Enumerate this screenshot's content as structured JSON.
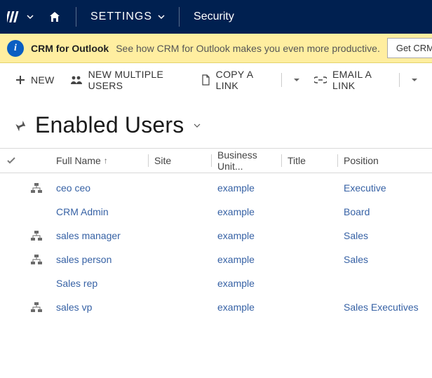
{
  "topnav": {
    "area_label": "SETTINGS",
    "subarea_label": "Security"
  },
  "notice": {
    "title": "CRM for Outlook",
    "message": "See how CRM for Outlook makes you even more productive.",
    "button_label": "Get CRM for Outlook"
  },
  "commands": {
    "new": "NEW",
    "new_multiple": "NEW MULTIPLE USERS",
    "copy_link": "COPY A LINK",
    "email_link": "EMAIL A LINK"
  },
  "view": {
    "title": "Enabled Users"
  },
  "grid": {
    "columns": {
      "full_name": "Full Name",
      "site": "Site",
      "business_unit": "Business Unit...",
      "title": "Title",
      "position": "Position"
    },
    "rows": [
      {
        "has_hierarchy": true,
        "full_name": "ceo ceo",
        "site": "",
        "business_unit": "example",
        "title": "",
        "position": "Executive"
      },
      {
        "has_hierarchy": false,
        "full_name": "CRM Admin",
        "site": "",
        "business_unit": "example",
        "title": "",
        "position": "Board"
      },
      {
        "has_hierarchy": true,
        "full_name": "sales manager",
        "site": "",
        "business_unit": "example",
        "title": "",
        "position": "Sales"
      },
      {
        "has_hierarchy": true,
        "full_name": "sales person",
        "site": "",
        "business_unit": "example",
        "title": "",
        "position": "Sales"
      },
      {
        "has_hierarchy": false,
        "full_name": "Sales rep",
        "site": "",
        "business_unit": "example",
        "title": "",
        "position": ""
      },
      {
        "has_hierarchy": true,
        "full_name": "sales vp",
        "site": "",
        "business_unit": "example",
        "title": "",
        "position": "Sales Executives"
      }
    ]
  }
}
